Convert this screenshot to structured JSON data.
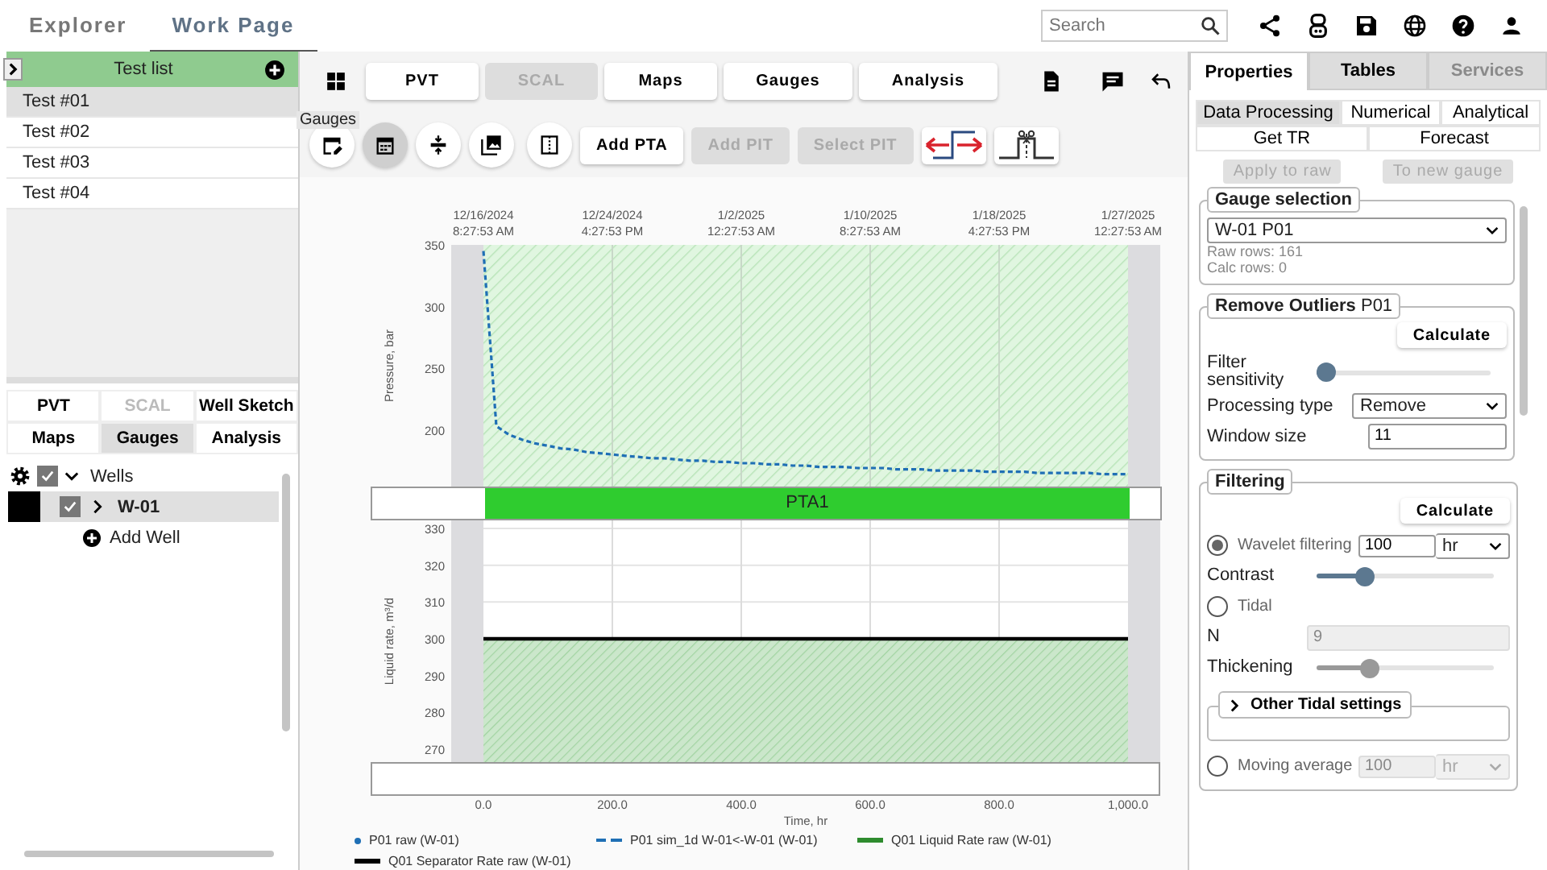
{
  "top_tabs": [
    {
      "label": "Explorer",
      "selected": false
    },
    {
      "label": "Work Page",
      "selected": true
    }
  ],
  "search": {
    "placeholder": "Search"
  },
  "test_list": {
    "title": "Test list",
    "items": [
      {
        "label": "Test #01",
        "selected": true
      },
      {
        "label": "Test #02",
        "selected": false
      },
      {
        "label": "Test #03",
        "selected": false
      },
      {
        "label": "Test #04",
        "selected": false
      }
    ]
  },
  "module_tabs": [
    {
      "label": "PVT",
      "selected": false,
      "disabled": false
    },
    {
      "label": "SCAL",
      "selected": false,
      "disabled": true
    },
    {
      "label": "Well Sketch",
      "selected": false,
      "disabled": false
    },
    {
      "label": "Maps",
      "selected": false,
      "disabled": false
    },
    {
      "label": "Gauges",
      "selected": true,
      "disabled": false
    },
    {
      "label": "Analysis",
      "selected": false,
      "disabled": false
    }
  ],
  "tree": {
    "label": "Wells",
    "checked": true,
    "expanded": true,
    "children": [
      {
        "label": "W-01",
        "checked": true,
        "expanded": false,
        "selected": true,
        "color": "#000000"
      }
    ],
    "add_label": "Add Well"
  },
  "toolbar_tabs": [
    {
      "label": "PVT",
      "disabled": false
    },
    {
      "label": "SCAL",
      "disabled": true
    },
    {
      "label": "Maps",
      "disabled": false
    },
    {
      "label": "Gauges",
      "disabled": false
    },
    {
      "label": "Analysis",
      "disabled": false
    }
  ],
  "tooltip": "Gauges",
  "tool_buttons": [
    {
      "kind": "edit-calendar",
      "selected": false
    },
    {
      "kind": "calendar",
      "selected": true
    },
    {
      "kind": "compress",
      "selected": false
    },
    {
      "kind": "images",
      "selected": false
    },
    {
      "kind": "split",
      "selected": false
    }
  ],
  "action_buttons": [
    {
      "label": "Add PTA",
      "disabled": false
    },
    {
      "label": "Add PIT",
      "disabled": true
    },
    {
      "label": "Select PIT",
      "disabled": true
    }
  ],
  "pressure_chart": {
    "chart_data": {
      "type": "line",
      "ylabel": "Pressure, bar",
      "grid": true,
      "categories": [
        "12/16/2024 8:27:53 AM",
        null,
        null,
        null,
        null,
        null,
        null,
        null,
        null,
        null,
        "12/24/2024 4:27:53 PM",
        null,
        null,
        null,
        null,
        null,
        null,
        null,
        null,
        null,
        "1/2/2025 12:27:53 AM",
        null,
        null,
        null,
        null,
        null,
        null,
        null,
        null,
        null,
        "1/10/2025 8:27:53 AM",
        null,
        null,
        null,
        null,
        null,
        null,
        null,
        null,
        null,
        "1/18/2025 4:27:53 PM",
        null,
        null,
        null,
        null,
        null,
        null,
        null,
        null,
        null,
        "1/27/2025 12:27:53 AM"
      ],
      "series": [
        {
          "color": "#1f6fb5",
          "line_style": "dashed",
          "values": [
            345,
            203,
            196,
            192,
            189,
            187,
            185,
            184,
            182,
            181,
            180,
            179,
            178,
            177,
            177,
            176,
            175,
            175,
            174,
            174,
            173,
            173,
            172,
            172,
            171,
            171,
            170,
            170,
            170,
            169,
            169,
            169,
            168,
            168,
            168,
            167,
            167,
            167,
            167,
            166,
            166,
            166,
            166,
            165,
            165,
            165,
            165,
            165,
            164,
            164,
            164
          ]
        }
      ],
      "ylim": [
        154,
        350
      ],
      "yticks": [
        200,
        250,
        300,
        350
      ]
    }
  },
  "pta_band": {
    "label": "PTA1"
  },
  "rate_chart": {
    "chart_data": {
      "type": "line",
      "grid": true,
      "xlabel": "Time, hr",
      "ylabel": "Liquid rate, m³/d",
      "x": [
        0,
        1000
      ],
      "series": [
        {
          "color": "#000000",
          "values": [
            300,
            300
          ]
        }
      ],
      "bands": [
        {
          "axis": "y",
          "from": 266.5,
          "to": 300,
          "color": "#2e9e2e"
        }
      ],
      "xlim": [
        0,
        1000
      ],
      "ylim": [
        266.5,
        332.2
      ],
      "yticks": [
        270,
        280,
        290,
        300,
        310,
        320,
        330
      ],
      "xticks": [
        {
          "value": 0,
          "label": "0.0"
        },
        {
          "value": 200,
          "label": "200.0"
        },
        {
          "value": 400,
          "label": "400.0"
        },
        {
          "value": 600,
          "label": "600.0"
        },
        {
          "value": 800,
          "label": "800.0"
        },
        {
          "value": 1000,
          "label": "1,000.0"
        }
      ]
    }
  },
  "legend": [
    {
      "name": "P01 raw (W-01)",
      "kind": "dot",
      "color": "#1f6fb5"
    },
    {
      "name": "P01 sim_1d W-01<-W-01 (W-01)",
      "kind": "dash",
      "color": "#1f6fb5"
    },
    {
      "name": "Q01 Liquid Rate raw (W-01)",
      "kind": "line",
      "color": "#2e8b2e"
    },
    {
      "name": "Q01 Separator Rate raw (W-01)",
      "kind": "line",
      "color": "#000000"
    }
  ],
  "right_tabs": [
    {
      "label": "Properties",
      "selected": true,
      "disabled": false
    },
    {
      "label": "Tables",
      "selected": false,
      "disabled": false
    },
    {
      "label": "Services",
      "selected": false,
      "disabled": true
    }
  ],
  "sub_tabs": [
    {
      "label": "Data Processing",
      "selected": true
    },
    {
      "label": "Numerical",
      "selected": false
    },
    {
      "label": "Analytical",
      "selected": false
    },
    {
      "label": "Get TR",
      "selected": false
    },
    {
      "label": "Forecast",
      "selected": false
    }
  ],
  "apply_buttons": [
    {
      "label": "Apply to raw",
      "disabled": true
    },
    {
      "label": "To new gauge",
      "disabled": true
    }
  ],
  "gauge_selection": {
    "title": "Gauge selection",
    "value": "W-01 P01",
    "raw_rows": "Raw rows: 161",
    "calc_rows": "Calc rows: 0"
  },
  "outliers": {
    "title": "**Remove Outliers** P01",
    "calculate": "Calculate",
    "sensitivity": {
      "label": "Filter sensitivity",
      "level": 0
    },
    "processing_type": {
      "label": "Processing type",
      "value": "Remove"
    },
    "window_size": {
      "label": "Window size",
      "value": "11"
    }
  },
  "filtering": {
    "title": "Filtering",
    "calculate": "Calculate",
    "rows": [
      {
        "kind": "radio",
        "label": "Wavelet filtering",
        "selected": true,
        "value": "100",
        "unit": "hr"
      },
      {
        "kind": "slider",
        "label": "Contrast",
        "level": 0.23
      },
      {
        "kind": "radio",
        "label": "Tidal",
        "selected": false
      },
      {
        "kind": "input",
        "label": "N",
        "value": "9",
        "disabled": true
      },
      {
        "kind": "slider",
        "label": "Thickening",
        "level": 0.26,
        "disabled": true
      },
      {
        "kind": "group",
        "label": "Other Tidal settings",
        "expanded": false
      },
      {
        "kind": "radio",
        "label": "Moving average",
        "selected": false,
        "value": "100",
        "unit": "hr",
        "disabled": true
      }
    ]
  }
}
